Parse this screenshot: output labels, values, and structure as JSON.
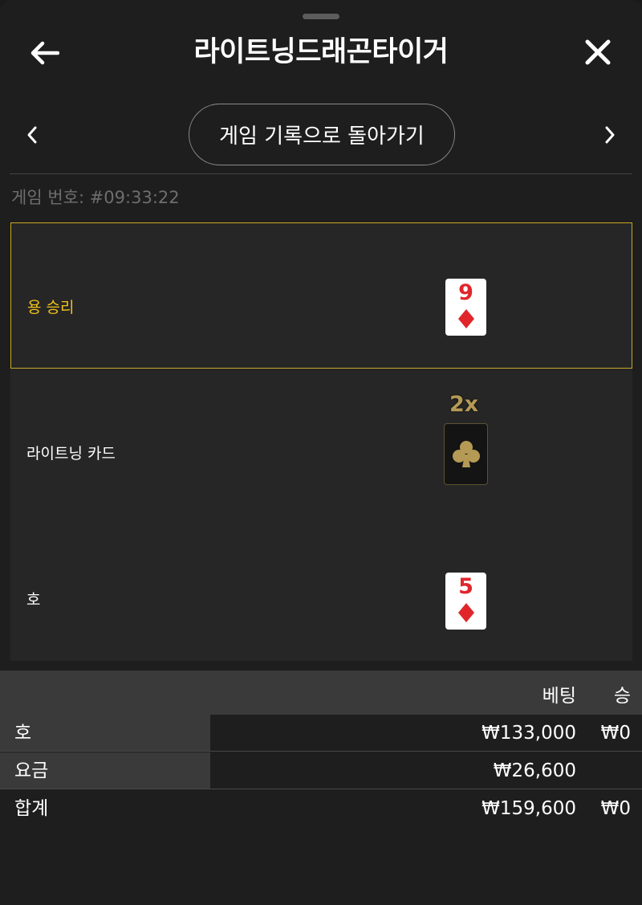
{
  "header": {
    "title": "라이트닝드래곤타이거",
    "back_icon": "arrow-left-icon",
    "close_icon": "close-icon"
  },
  "navigation": {
    "history_button_label": "게임 기록으로 돌아가기",
    "prev_icon": "chevron-left-icon",
    "next_icon": "chevron-right-icon"
  },
  "game_number": "게임 번호: #09:33:22",
  "results": [
    {
      "label": "용 승리",
      "card_rank": "9",
      "card_suit": "diamond",
      "winner": true
    },
    {
      "label": "라이트닝 카드",
      "card_suit": "club",
      "multiplier": "2x"
    },
    {
      "label": "호",
      "card_rank": "5",
      "card_suit": "diamond"
    }
  ],
  "table": {
    "headers": {
      "bet": "베팅",
      "win": "승"
    },
    "rows": [
      {
        "name": "호",
        "bet": "₩133,000",
        "win": "₩0"
      },
      {
        "name": "요금",
        "bet": "₩26,600",
        "win": ""
      }
    ],
    "total": {
      "name": "합계",
      "bet": "₩159,600",
      "win": "₩0"
    }
  },
  "colors": {
    "accent_gold": "#f2c21b",
    "card_red": "#e0262b",
    "lightning_gold": "#b59a55"
  }
}
